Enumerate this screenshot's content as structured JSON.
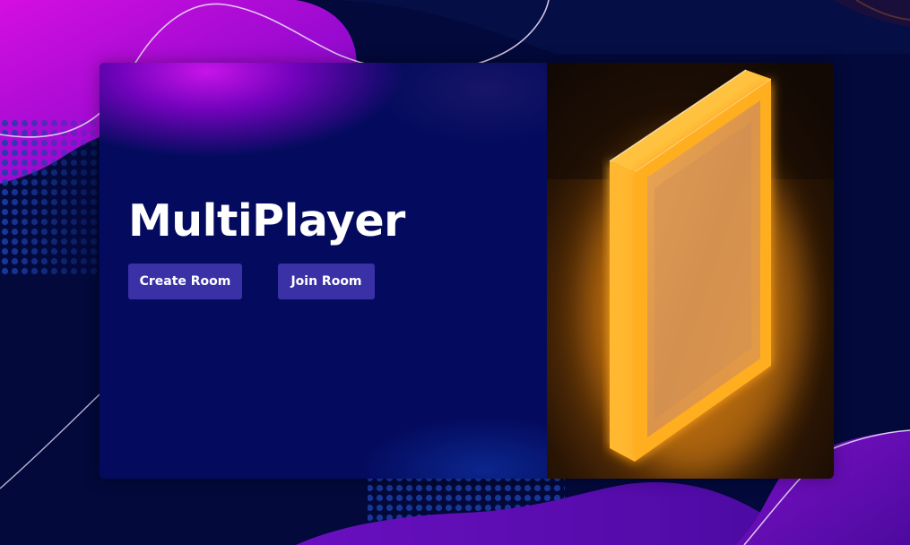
{
  "hero": {
    "title": "MultiPlayer"
  },
  "actions": {
    "create_room_label": "Create Room",
    "join_room_label": "Join Room"
  },
  "colors": {
    "page_background": "#03093a",
    "card_background": "#040b5e",
    "button_background": "#3a31a6",
    "accent_magenta": "#c40ee8",
    "accent_purple": "#5a0aa6",
    "portal_glow": "#ffb21c"
  },
  "illustration": {
    "name": "glowing-portal-image"
  }
}
